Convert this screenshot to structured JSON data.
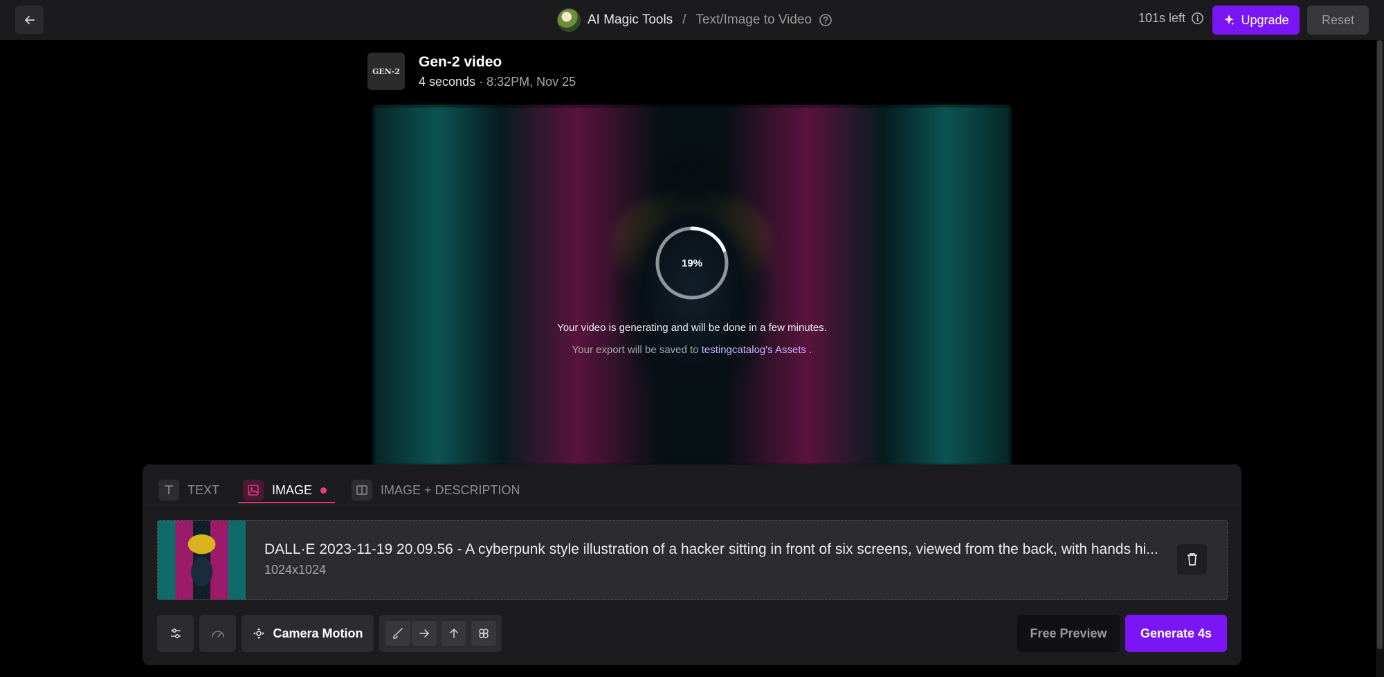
{
  "header": {
    "app_name": "AI Magic Tools",
    "separator": "/",
    "page_name": "Text/Image to Video",
    "credits_left": "101s left",
    "upgrade_label": "Upgrade",
    "reset_label": "Reset"
  },
  "asset": {
    "thumb_label": "GEN-2",
    "title": "Gen-2 video",
    "duration": "4 seconds",
    "dot": "·",
    "timestamp": "8:32PM, Nov 25"
  },
  "generation": {
    "progress_percent": 19,
    "progress_label": "19%",
    "status_message": "Your video is generating and will be done in a few minutes.",
    "export_prefix": "Your export will be saved to",
    "export_user": "testingcatalog",
    "export_suffix": "'s Assets",
    "export_end": "."
  },
  "tabs": [
    {
      "label": "TEXT",
      "icon": "text-icon",
      "active": false
    },
    {
      "label": "IMAGE",
      "icon": "image-icon",
      "active": true
    },
    {
      "label": "IMAGE + DESCRIPTION",
      "icon": "split-layout-icon",
      "active": false
    }
  ],
  "file": {
    "name": "DALL·E 2023-11-19 20.09.56 - A cyberpunk style illustration of a hacker sitting in front of six screens, viewed from the back, with hands hi...",
    "dimensions": "1024x1024"
  },
  "toolbar": {
    "camera_motion_label": "Camera Motion",
    "free_preview_label": "Free Preview",
    "generate_label": "Generate 4s"
  },
  "colors": {
    "accent": "#7a16f5",
    "tab_active": "#e0357a",
    "panel_bg": "#1c1c1f"
  }
}
